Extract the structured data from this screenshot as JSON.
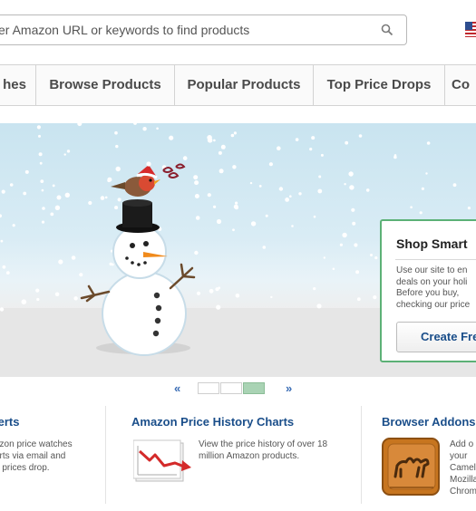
{
  "search": {
    "placeholder": "er Amazon URL or keywords to find products"
  },
  "nav": {
    "tabs": [
      "hes",
      "Browse Products",
      "Popular Products",
      "Top Price Drops",
      "Co"
    ]
  },
  "promo": {
    "title": "Shop Smart",
    "lines": [
      "Use our site to en",
      "deals on your holi",
      "Before you buy,",
      "checking our price"
    ],
    "button": "Create Fre"
  },
  "pager": {
    "prev": "«",
    "next": "»",
    "total": 3,
    "active": 3
  },
  "features": [
    {
      "title": "lerts",
      "lines": [
        "azon price watches",
        "erts via email and",
        "n prices drop."
      ]
    },
    {
      "title": "Amazon Price History Charts",
      "lines": [
        "View the price history of over 18",
        "million Amazon products."
      ]
    },
    {
      "title": "Browser Addons",
      "lines": [
        "Add o",
        "your",
        "Camel",
        "Mozilla",
        "Chrom"
      ]
    }
  ],
  "colors": {
    "accent": "#1a4e8a",
    "promo_border": "#5cb176",
    "active_dot": "#a9d3b4"
  }
}
